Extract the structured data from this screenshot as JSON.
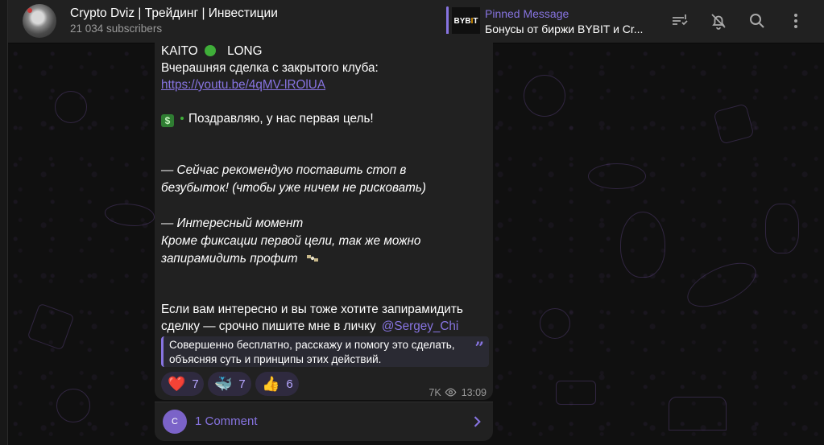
{
  "header": {
    "title": "Crypto Dviz | Трейдинг | Инвестиции",
    "subscribers": "21 034 subscribers",
    "pinned_label": "Pinned Message",
    "pinned_text": "Бонусы от биржи BYBIT и Cr...",
    "pinned_thumb_text_a": "BYB",
    "pinned_thumb_text_b": "I",
    "pinned_thumb_text_c": "T"
  },
  "message": {
    "line1_prefix": "KAITO",
    "line1_suffix": "LONG",
    "line2": "Вчерашняя сделка с закрытого клуба:",
    "link": "https://youtu.be/4qMV-lROlUA",
    "congrats": "Поздравляю, у нас первая цель!",
    "stop_line1": "— Сейчас рекомендую поставить стоп в",
    "stop_line2": "безубыток! (чтобы уже ничем не рисковать)",
    "moment_line1": "— Интересный момент",
    "moment_line2": "Кроме фиксации первой цели, так же можно",
    "moment_line3": "запирамидить профит",
    "cta_line1": "Если вам интересно и вы тоже хотите запирамидить",
    "cta_line2": "сделку — срочно пишите мне в личку",
    "mention": "@Sergey_Chi",
    "quote_line1": "Совершенно бесплатно, расскажу и помогу это сделать,",
    "quote_line2": "объясняя суть и принципы этих действий."
  },
  "reactions": [
    {
      "emoji": "❤️",
      "count": "7"
    },
    {
      "emoji": "🐳",
      "count": "7"
    },
    {
      "emoji": "👍",
      "count": "6"
    }
  ],
  "meta": {
    "views": "7K",
    "time": "13:09"
  },
  "comments": {
    "avatar_letter": "C",
    "label": "1 Comment"
  },
  "icons": [
    "ticket-icon",
    "bell-off-icon",
    "search-icon",
    "more-vertical-icon",
    "eye-icon",
    "chevron-right-icon"
  ],
  "colors": {
    "accent": "#8774e1",
    "bubble": "#212121",
    "header": "#212121",
    "background": "#101010"
  }
}
